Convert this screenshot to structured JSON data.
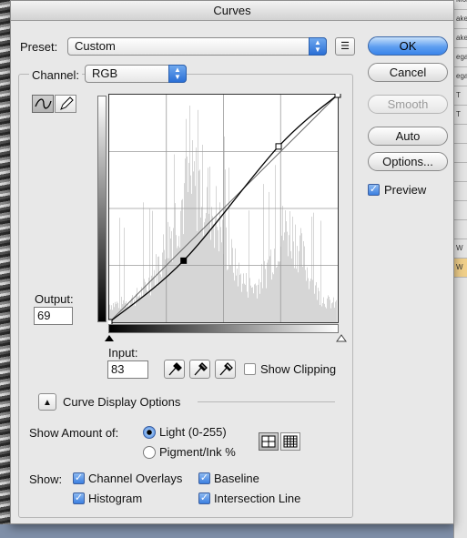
{
  "dialog": {
    "title": "Curves"
  },
  "preset": {
    "label": "Preset:",
    "value": "Custom"
  },
  "channel": {
    "label": "Channel:",
    "value": "RGB"
  },
  "buttons": {
    "ok": "OK",
    "cancel": "Cancel",
    "smooth": "Smooth",
    "auto": "Auto",
    "options": "Options..."
  },
  "preview": {
    "label": "Preview",
    "checked": true
  },
  "output": {
    "label": "Output:",
    "value": "69"
  },
  "input": {
    "label": "Input:",
    "value": "83"
  },
  "show_clipping": {
    "label": "Show Clipping",
    "checked": false
  },
  "curve_display": {
    "label": "Curve Display Options"
  },
  "show_amount": {
    "label": "Show Amount of:",
    "light": "Light  (0-255)",
    "pigment": "Pigment/Ink %",
    "selected": "light"
  },
  "show": {
    "label": "Show:",
    "channel_overlays": "Channel Overlays",
    "baseline": "Baseline",
    "histogram": "Histogram",
    "intersection_line": "Intersection Line"
  },
  "curve": {
    "points": [
      [
        0,
        0
      ],
      [
        83,
        69
      ],
      [
        189,
        197
      ],
      [
        255,
        255
      ]
    ]
  },
  "background_panel": [
    "Molte",
    "ake",
    "ake",
    "ega",
    "ega",
    "T",
    "T",
    "",
    "",
    "",
    "",
    "",
    "",
    "W",
    "W"
  ],
  "colors": {
    "accent": "#3b7fe0",
    "dialog_bg": "#e8e8e8"
  }
}
